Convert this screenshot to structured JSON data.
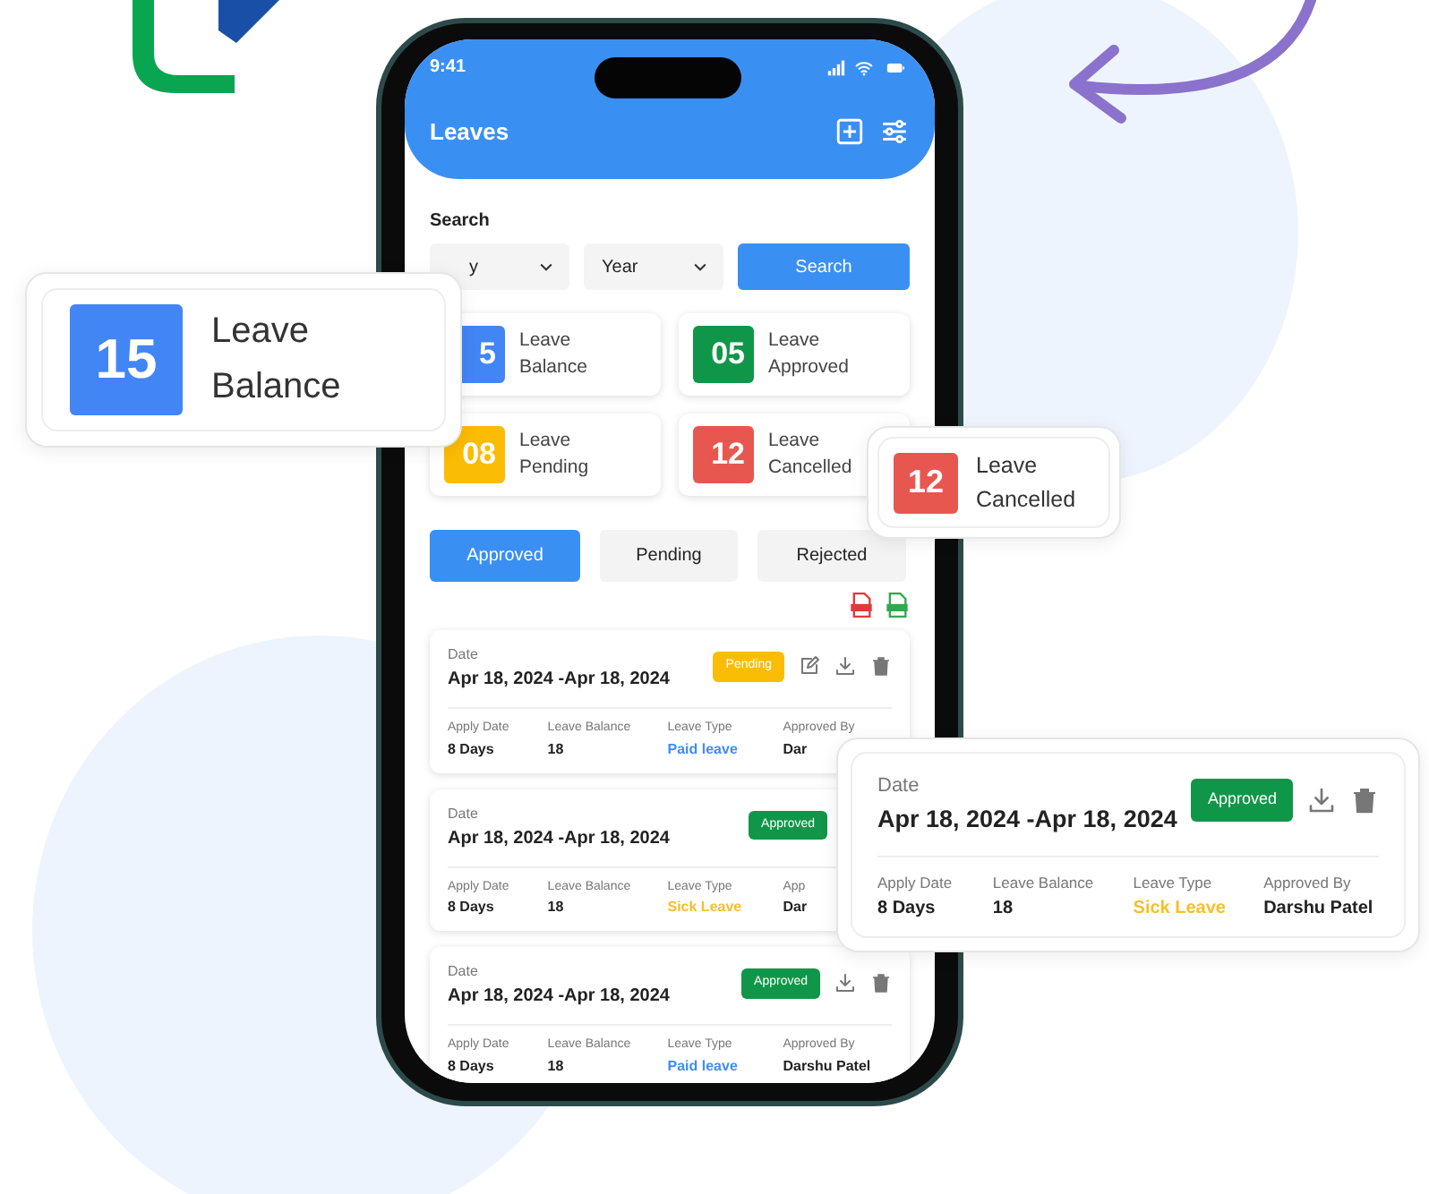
{
  "phone": {
    "status_bar": {
      "time": "9:41"
    },
    "header": {
      "title": "Leaves"
    },
    "search": {
      "label": "Search",
      "month": {
        "value": "y"
      },
      "year": {
        "value": "Year"
      },
      "button": "Search"
    },
    "stats": [
      {
        "value": "5",
        "label": "Leave Balance",
        "color": "#4285f4"
      },
      {
        "value": "05",
        "label": "Leave Approved",
        "color": "#109648"
      },
      {
        "value": "08",
        "label": "Leave Pending",
        "color": "#fbbc05"
      },
      {
        "value": "12",
        "label": "Leave Cancelled",
        "color": "#e8574f"
      }
    ],
    "tabs": [
      {
        "label": "Approved",
        "selected": true
      },
      {
        "label": "Pending",
        "selected": false
      },
      {
        "label": "Rejected",
        "selected": false
      }
    ],
    "leaves": [
      {
        "date_label": "Date",
        "range": "Apr 18, 2024 -Apr 18, 2024",
        "status": {
          "text": "Pending",
          "color": "#fbbc05"
        },
        "can_edit": true,
        "can_download": true,
        "can_delete": true,
        "fields": [
          {
            "label": "Apply Date",
            "value": "8 Days"
          },
          {
            "label": "Leave Balance",
            "value": "18"
          },
          {
            "label": "Leave Type",
            "value": "Paid leave",
            "color": "#3d8ef5"
          },
          {
            "label": "Approved By",
            "value": "Dar"
          }
        ]
      },
      {
        "date_label": "Date",
        "range": "Apr 18, 2024 -Apr 18, 2024",
        "status": {
          "text": "Approved",
          "color": "#109648"
        },
        "fields": [
          {
            "label": "Apply Date",
            "value": "8 Days"
          },
          {
            "label": "Leave Balance",
            "value": "18"
          },
          {
            "label": "Leave Type",
            "value": "Sick Leave",
            "color": "#f5c02a"
          },
          {
            "label": "App",
            "value": "Dar"
          }
        ]
      },
      {
        "date_label": "Date",
        "range": "Apr 18, 2024 -Apr 18, 2024",
        "status": {
          "text": "Approved",
          "color": "#109648"
        },
        "can_download": true,
        "can_delete": true,
        "fields": [
          {
            "label": "Apply Date",
            "value": "8 Days"
          },
          {
            "label": "Leave Balance",
            "value": "18"
          },
          {
            "label": "Leave Type",
            "value": "Paid leave",
            "color": "#3d8ef5"
          },
          {
            "label": "Approved By",
            "value": "Darshu Patel"
          }
        ]
      }
    ]
  },
  "callouts": [
    {
      "kind": "stat",
      "value": "15",
      "label": "Leave Balance",
      "color": "#4285f4"
    },
    {
      "kind": "stat",
      "value": "12",
      "label": "Leave Cancelled",
      "color": "#e8574f"
    },
    {
      "kind": "leave",
      "date_label": "Date",
      "range": "Apr 18, 2024 -Apr 18, 2024",
      "status": {
        "text": "Approved",
        "color": "#109648"
      },
      "can_download": true,
      "can_delete": true,
      "fields": [
        {
          "label": "Apply Date",
          "value": "8 Days"
        },
        {
          "label": "Leave Balance",
          "value": "18"
        },
        {
          "label": "Leave Type",
          "value": "Sick Leave",
          "color": "#f5c02a"
        },
        {
          "label": "Approved By",
          "value": "Darshu Patel"
        }
      ]
    }
  ]
}
